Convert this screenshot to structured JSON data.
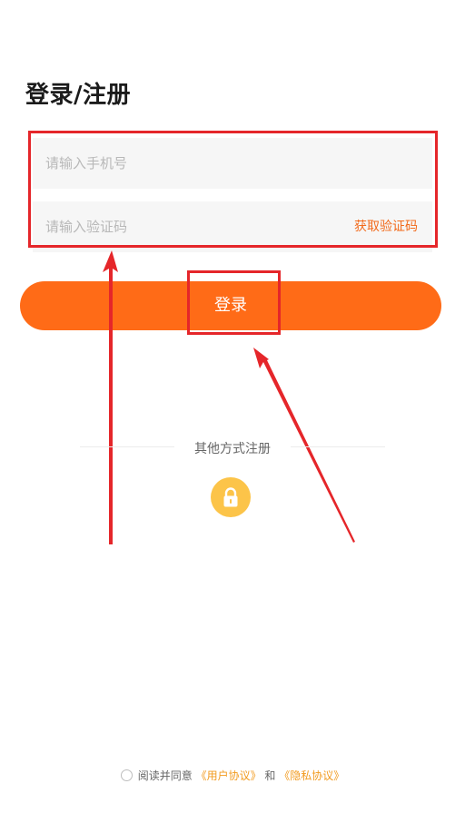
{
  "header": {
    "title": "登录/注册"
  },
  "form": {
    "phone_placeholder": "请输入手机号",
    "code_placeholder": "请输入验证码",
    "get_code_label": "获取验证码",
    "submit_label": "登录"
  },
  "other_methods": {
    "label": "其他方式注册",
    "lock_icon": "lock-icon"
  },
  "agreement": {
    "prefix": "阅读并同意",
    "user_agreement": "《用户协议》",
    "conjunction": "和",
    "privacy_agreement": "《隐私协议》"
  },
  "colors": {
    "primary": "#ff6b17",
    "link": "#f29b1f",
    "lock_bg": "#fcc449",
    "annotation": "#e5262a"
  }
}
